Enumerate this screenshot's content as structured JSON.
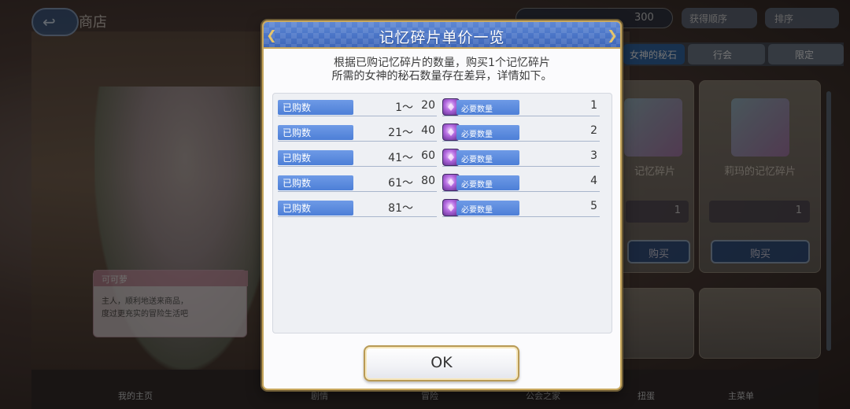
{
  "background": {
    "back_icon": "↩",
    "shop_title": "商店",
    "currency_value": "300",
    "sort_button": "获得顺序",
    "order_button": "排序",
    "tabs": [
      "女神的秘石",
      "行会",
      "限定"
    ],
    "cards": [
      {
        "name": "记忆碎片",
        "cost": "1",
        "buy": "购买"
      },
      {
        "name": "莉玛的记忆碎片",
        "cost": "1",
        "buy": "购买"
      }
    ],
    "speech": {
      "speaker": "可可萝",
      "lines": [
        "主人，顺利地送来商品，",
        "度过更充实的冒险生活吧"
      ]
    },
    "bottom_nav": [
      "我的主页",
      "剧情",
      "冒险",
      "公会之家",
      "扭蛋",
      "主菜单"
    ]
  },
  "dialog": {
    "title": "记忆碎片单价一览",
    "description_lines": [
      "根据已购记忆碎片的数量，购买1个记忆碎片",
      "所需的女神的秘石数量存在差异，详情如下。"
    ],
    "row_label": "已购数",
    "req_label": "必要数量",
    "rows": [
      {
        "from": "1～",
        "to": "20",
        "qty": "1"
      },
      {
        "from": "21～",
        "to": "40",
        "qty": "2"
      },
      {
        "from": "41～",
        "to": "60",
        "qty": "3"
      },
      {
        "from": "61～",
        "to": "80",
        "qty": "4"
      },
      {
        "from": "81～",
        "to": "",
        "qty": "5"
      }
    ],
    "ok_label": "OK"
  },
  "colors": {
    "header_blue": "#4a74c6",
    "label_blue": "#5585da",
    "gold_border": "#c9a85e"
  }
}
